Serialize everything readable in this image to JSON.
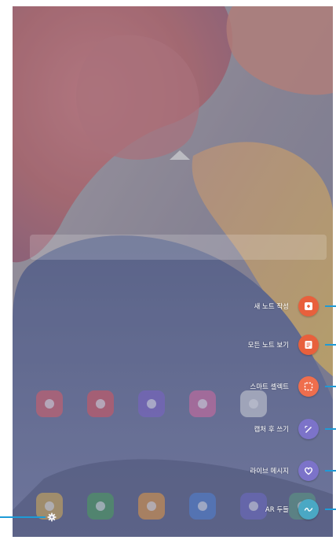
{
  "air_command": {
    "items": [
      {
        "label": "새 노트 작성",
        "icon": "create-note-icon",
        "color": "#e8603c"
      },
      {
        "label": "모든 노트 보기",
        "icon": "view-all-notes-icon",
        "color": "#e8603c"
      },
      {
        "label": "스마트 셀렉트",
        "icon": "smart-select-icon",
        "color": "#ef6e4d"
      },
      {
        "label": "캡처 후 쓰기",
        "icon": "screen-write-icon",
        "color": "#7c73c9"
      },
      {
        "label": "라이브 메시지",
        "icon": "live-message-icon",
        "color": "#7c73c9"
      },
      {
        "label": "AR 두들",
        "icon": "ar-doodle-icon",
        "color": "#4aa8c4"
      }
    ]
  },
  "settings": {
    "icon": "gear-icon"
  },
  "colors": {
    "callout": "#1e9bd7"
  }
}
